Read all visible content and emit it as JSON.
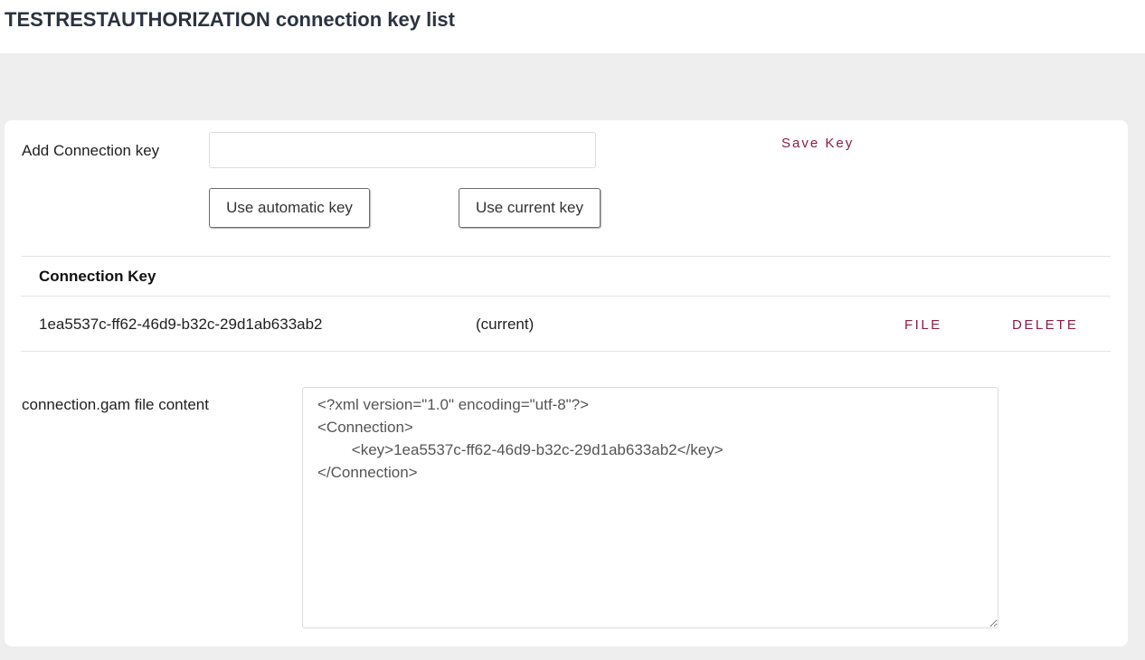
{
  "header": {
    "title": "TESTRESTAUTHORIZATION connection key list"
  },
  "add_key": {
    "label": "Add Connection key",
    "input_value": "",
    "save_label": "Save Key",
    "auto_button_label": "Use automatic key",
    "current_button_label": "Use current key"
  },
  "table": {
    "column_header": "Connection Key",
    "rows": [
      {
        "key": "1ea5537c-ff62-46d9-b32c-29d1ab633ab2",
        "status": "(current)",
        "file_action": "FILE",
        "delete_action": "DELETE"
      }
    ]
  },
  "file": {
    "label": "connection.gam file content",
    "content": "<?xml version=\"1.0\" encoding=\"utf-8\"?>\n<Connection>\n\t<key>1ea5537c-ff62-46d9-b32c-29d1ab633ab2</key>\n</Connection>"
  },
  "colors": {
    "accent": "#8c1b47",
    "title": "#2b3340",
    "background": "#eeeeee"
  }
}
